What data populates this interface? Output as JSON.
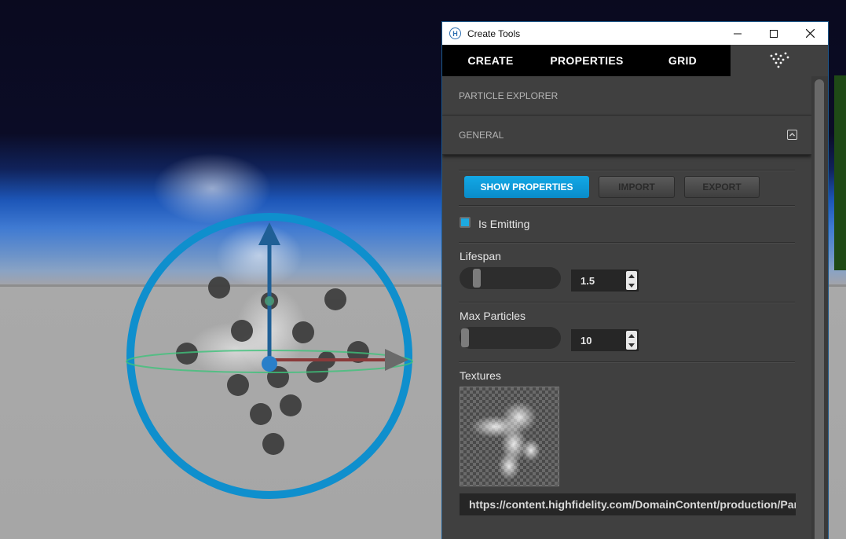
{
  "window": {
    "title": "Create Tools"
  },
  "tabs": [
    {
      "label": "CREATE"
    },
    {
      "label": "PROPERTIES"
    },
    {
      "label": "GRID"
    }
  ],
  "particle_tab_icon": "particle-explorer-icon",
  "sections": {
    "particle_explorer": "PARTICLE EXPLORER",
    "general": "GENERAL"
  },
  "buttons": {
    "show_properties": "SHOW PROPERTIES",
    "import": "IMPORT",
    "export": "EXPORT"
  },
  "is_emitting": {
    "label": "Is Emitting",
    "checked": true
  },
  "lifespan": {
    "label": "Lifespan",
    "value": "1.5",
    "slider_fraction": 0.12
  },
  "max_particles": {
    "label": "Max Particles",
    "value": "10",
    "slider_fraction": 0.02
  },
  "textures": {
    "label": "Textures",
    "url": "https://content.highfidelity.com/DomainContent/production/Particles/smoke.png"
  },
  "colors": {
    "accent": "#0a9fde",
    "panel_bg": "#404040",
    "tab_bar": "#000000",
    "gizmo_ring": "#0f8fcd"
  }
}
